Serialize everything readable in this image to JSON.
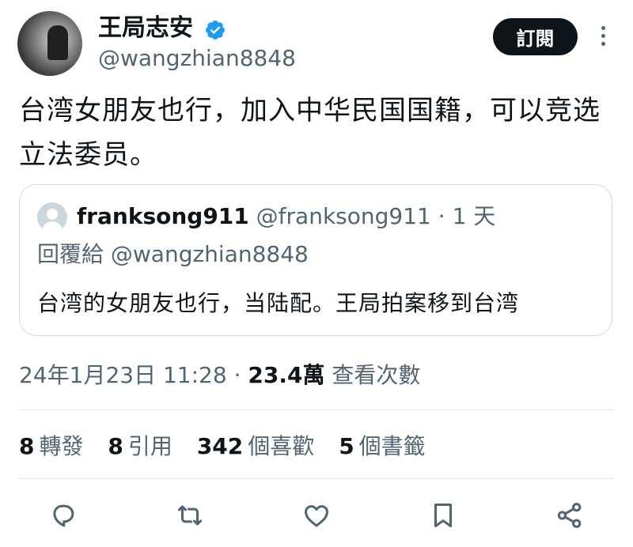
{
  "author": {
    "name": "王局志安",
    "handle": "@wangzhian8848",
    "verified_color": "#1d9bf0"
  },
  "header": {
    "subscribe_label": "訂閱"
  },
  "tweet": {
    "text": "台湾女朋友也行，加入中华民国国籍，可以竞选立法委员。"
  },
  "quote": {
    "name": "franksong911",
    "handle": "@franksong911",
    "separator": "·",
    "time": "1 天",
    "reply_to": "回覆給 @wangzhian8848",
    "text": "台湾的女朋友也行，当陆配。王局拍案移到台湾"
  },
  "meta": {
    "datetime": "24年1月23日 11:28",
    "separator": "·",
    "views_count": "23.4萬",
    "views_label": "查看次數"
  },
  "stats": [
    {
      "count": "8",
      "label": "轉發"
    },
    {
      "count": "8",
      "label": "引用"
    },
    {
      "count": "342",
      "label": "個喜歡"
    },
    {
      "count": "5",
      "label": "個書籤"
    }
  ],
  "actions": [
    "reply-icon",
    "retweet-icon",
    "like-icon",
    "bookmark-icon",
    "share-icon"
  ],
  "colors": {
    "text": "#0f1419",
    "secondary": "#536471",
    "border": "#cfd9de",
    "icon": "#536471"
  }
}
